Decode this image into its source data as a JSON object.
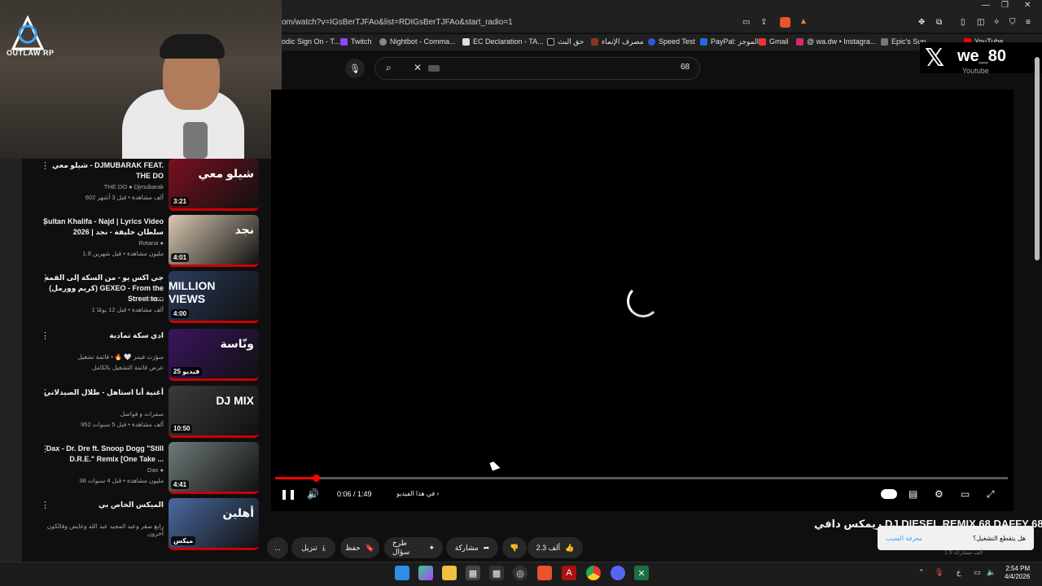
{
  "browser": {
    "url": "om/watch?v=IGsBerTJFAo&list=RDIGsBerTJFAo&start_radio=1",
    "bookmarks": [
      "odic Sign On - T...",
      "Twitch",
      "Nightbot - Comma...",
      "EC Declaration - TA...",
      "حق البث",
      "مصرف الإنماء",
      "Speed Test",
      "PayPal: الموجز",
      "Gmail",
      "@ wa.dw • Instagra...",
      "Epic's Sup",
      "YouTube"
    ]
  },
  "overlay": {
    "logo_text": "OUTLAW RP",
    "x_handle": "we_80",
    "yt_label": "Youtube"
  },
  "search": {
    "count": "68"
  },
  "playlist": [
    {
      "title": "شيلو معي - DJMUBARAK FEAT. THE DO",
      "channel": "THE DO ● Djmubarak",
      "meta": "602 ألف مشاهدة • قبل 3 أشهر",
      "duration": "3:21",
      "thumb_text": "شيلو معي",
      "thumb_color": "#7a1020"
    },
    {
      "title": "Sultan Khalifa - Najd | Lyrics Video 2026 | سلطان خليفة - نجد",
      "channel": "Rotana ●",
      "meta": "1.9 مليون مشاهدة • قبل شهرين",
      "duration": "4:01",
      "thumb_text": "نجد",
      "thumb_color": "#d9c9b2"
    },
    {
      "title": "جي اكس يو - من السكة إلى القمة (كريم وورمل) GEXEO - From the Street to...",
      "channel": "GEXEO",
      "meta": "1 ألف مشاهدة • قبل 12 يومًا",
      "duration": "4:00",
      "thumb_text": "MILLION VIEWS",
      "thumb_color": "#2a3c5c"
    },
    {
      "title": "ادي سكة تمادية",
      "channel": "سؤرَت فيمز 🤍 🔥 • قائمة تشغيل",
      "meta": "عرض قائمة التشغيل بالكامل",
      "duration": "25 فيديو",
      "thumb_text": "ونّاسة",
      "thumb_color": "#3a1460"
    },
    {
      "title": "أغنية أنا استاهل - طلال الصيدلاني",
      "channel": "سمرات و فواصل",
      "meta": "952 ألف مشاهدة • قبل 5 سنوات",
      "duration": "10:50",
      "thumb_text": "DJ MIX",
      "thumb_color": "#3b3b3b"
    },
    {
      "title": "Dax - Dr. Dre ft. Snoop Dogg \"Still D.R.E.\" Remix [One Take ...",
      "channel": "Dax ●",
      "meta": "38 مليون مشاهدة • قبل 4 سنوات",
      "duration": "4:41",
      "thumb_text": "",
      "thumb_color": "#6f7a7a"
    },
    {
      "title": "الميكس الخاص بي",
      "channel": "رابع صقر وعبد المجيد عبد الله وعايض وفالكون أخرون",
      "meta": "",
      "duration": "ميكس",
      "thumb_text": "أهلين",
      "thumb_color": "#4a6aa0"
    }
  ],
  "player": {
    "time": "0:06 / 1:49",
    "progress": 0.055,
    "chapter": "في هذا الفيديو",
    "cursor": "pointer"
  },
  "video": {
    "title": "ريمكس دافي DJ DIESEL REMIX 68 DAFFY 68"
  },
  "actions": {
    "likes": "2.3 ألف",
    "share": "مشاركة",
    "ask": "طرح سؤال",
    "save": "حفظ",
    "download": "تنزيل",
    "more": "..."
  },
  "toast": {
    "question": "هل يتقطع التشغيل؟",
    "link": "معرفة السبب"
  },
  "under_toast": "1.9 ألف مشاركة",
  "taskbar": {
    "time": "2:54 PM",
    "date": "4/4/2026",
    "lang": "ع"
  }
}
